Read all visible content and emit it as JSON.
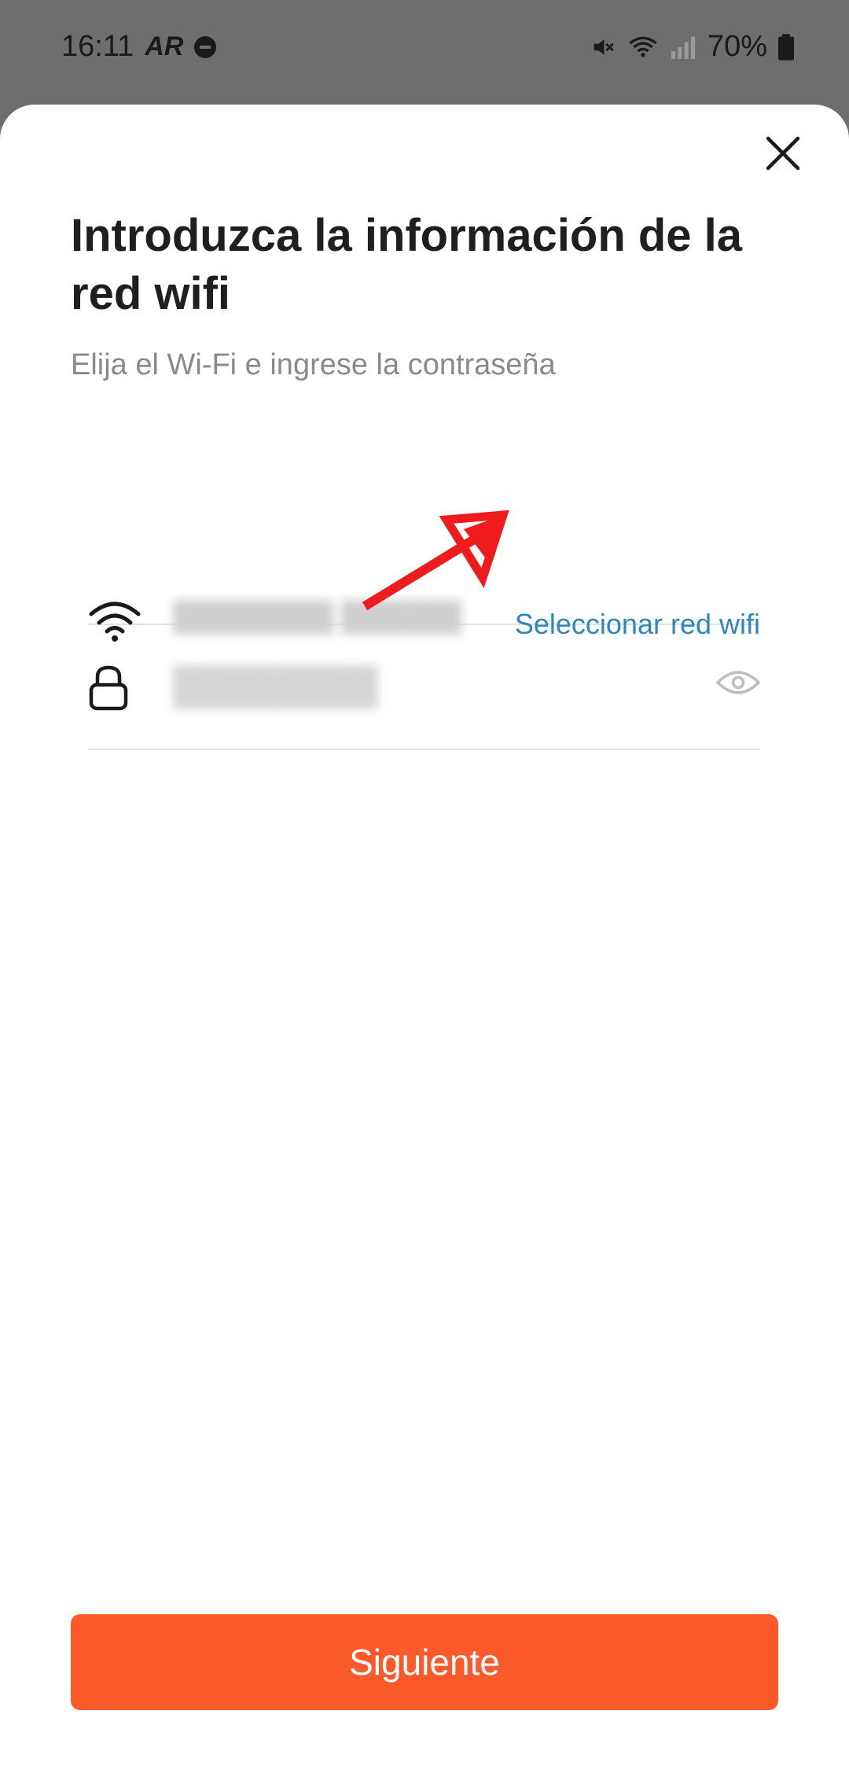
{
  "status_bar": {
    "time": "16:11",
    "carrier_glyph": "AR",
    "battery": "70%"
  },
  "sheet": {
    "title": "Introduzca la información de la red wifi",
    "subtitle": "Elija el Wi-Fi e ingrese la contraseña",
    "wifi_row": {
      "select_link": "Seleccionar red wifi"
    },
    "password_row": {},
    "next_button": "Siguiente"
  },
  "colors": {
    "accent_orange": "#fd5a2c",
    "link_blue": "#2f86bd",
    "annotation_red": "#ee1c1c"
  },
  "icons": [
    "close-icon",
    "wifi-icon",
    "lock-icon",
    "eye-icon",
    "arrow-annotation"
  ]
}
